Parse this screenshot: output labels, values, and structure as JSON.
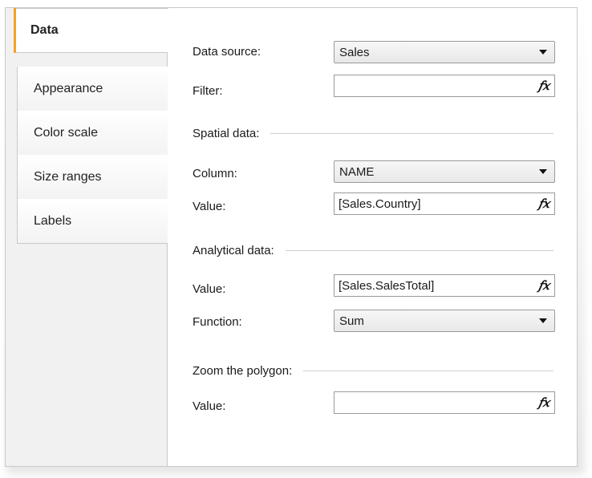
{
  "tabs": [
    {
      "label": "Data",
      "active": true
    },
    {
      "label": "Appearance",
      "active": false
    },
    {
      "label": "Color scale",
      "active": false
    },
    {
      "label": "Size ranges",
      "active": false
    },
    {
      "label": "Labels",
      "active": false
    }
  ],
  "form": {
    "data_source": {
      "label": "Data source:",
      "value": "Sales"
    },
    "filter": {
      "label": "Filter:",
      "value": "",
      "icon": "fx-icon"
    },
    "spatial_section": "Spatial data:",
    "spatial_column": {
      "label": "Column:",
      "value": "NAME"
    },
    "spatial_value": {
      "label": "Value:",
      "value": "[Sales.Country]",
      "icon": "fx-icon"
    },
    "analytical_section": "Analytical data:",
    "analytical_value": {
      "label": "Value:",
      "value": "[Sales.SalesTotal]",
      "icon": "fx-icon"
    },
    "analytical_function": {
      "label": "Function:",
      "value": "Sum"
    },
    "zoom_section": "Zoom the polygon:",
    "zoom_value": {
      "label": "Value:",
      "value": "",
      "icon": "fx-icon"
    }
  },
  "colors": {
    "active_tab_accent": "#f3a229",
    "tab_background": "#f1f1f1",
    "border": "#c9c9c9"
  },
  "icons": {
    "fx": "𝑓𝑥",
    "dropdown": "chevron-down-icon"
  }
}
